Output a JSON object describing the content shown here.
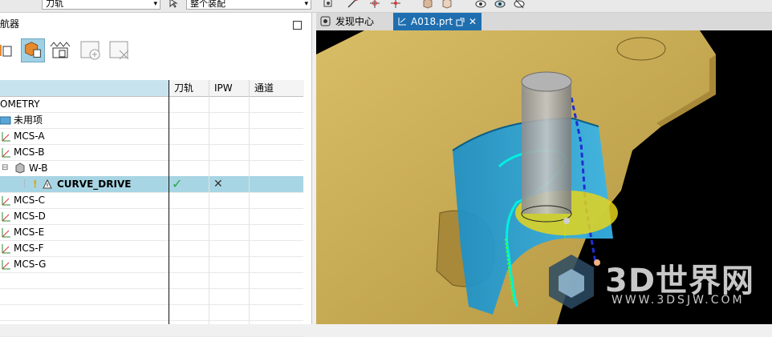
{
  "toolbar": {
    "combo1_value": "刀轨",
    "combo2_value": "整个装配",
    "dropdown_arrow": "▾"
  },
  "navigator": {
    "title": "航器",
    "columns": [
      "",
      "刀轨",
      "IPW",
      "通道"
    ]
  },
  "tree": {
    "rows": [
      {
        "label": "OMETRY"
      },
      {
        "label": "未用项"
      },
      {
        "label": "MCS-A"
      },
      {
        "label": "MCS-B"
      },
      {
        "label": "W-B",
        "toggle": "⊟"
      },
      {
        "label": "CURVE_DRIVE",
        "warn": "!",
        "toolpath": "✓",
        "ipw": "✕"
      },
      {
        "label": "MCS-C"
      },
      {
        "label": "MCS-D"
      },
      {
        "label": "MCS-E"
      },
      {
        "label": "MCS-F"
      },
      {
        "label": "MCS-G"
      }
    ]
  },
  "tabs": {
    "discovery": "发现中心",
    "file": "A018.prt",
    "close": "✕"
  },
  "watermark": {
    "brand": "3D世界网",
    "url": "WWW.3DSJW.COM"
  },
  "colors": {
    "selection": "#a8d5e3",
    "header": "#c6e3ee",
    "active_tab": "#1f6fb0",
    "part": "#c9a94e",
    "blank": "#1ea0d8",
    "check": "#28a745"
  }
}
